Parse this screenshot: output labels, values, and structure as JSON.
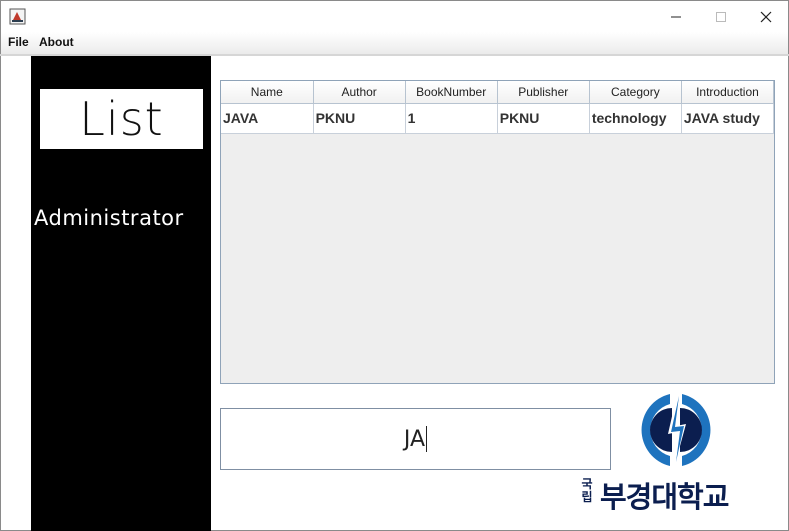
{
  "window": {
    "minimize_glyph": "—",
    "maximize_glyph": "☐",
    "close_glyph": "✕"
  },
  "menu": {
    "file": "File",
    "about": "About"
  },
  "sidebar": {
    "list_label": "List",
    "admin_label": "Administrator"
  },
  "table": {
    "columns": [
      "Name",
      "Author",
      "BookNumber",
      "Publisher",
      "Category",
      "Introduction"
    ],
    "rows": [
      [
        "JAVA",
        "PKNU",
        "1",
        "PKNU",
        "technology",
        "JAVA study"
      ]
    ]
  },
  "search": {
    "value": "JA"
  },
  "logo": {
    "small_text": "국립",
    "text": "부경대학교"
  },
  "colors": {
    "sidebar_bg": "#000000",
    "logo_blue": "#1e73be",
    "logo_navy": "#0b1e4f"
  }
}
